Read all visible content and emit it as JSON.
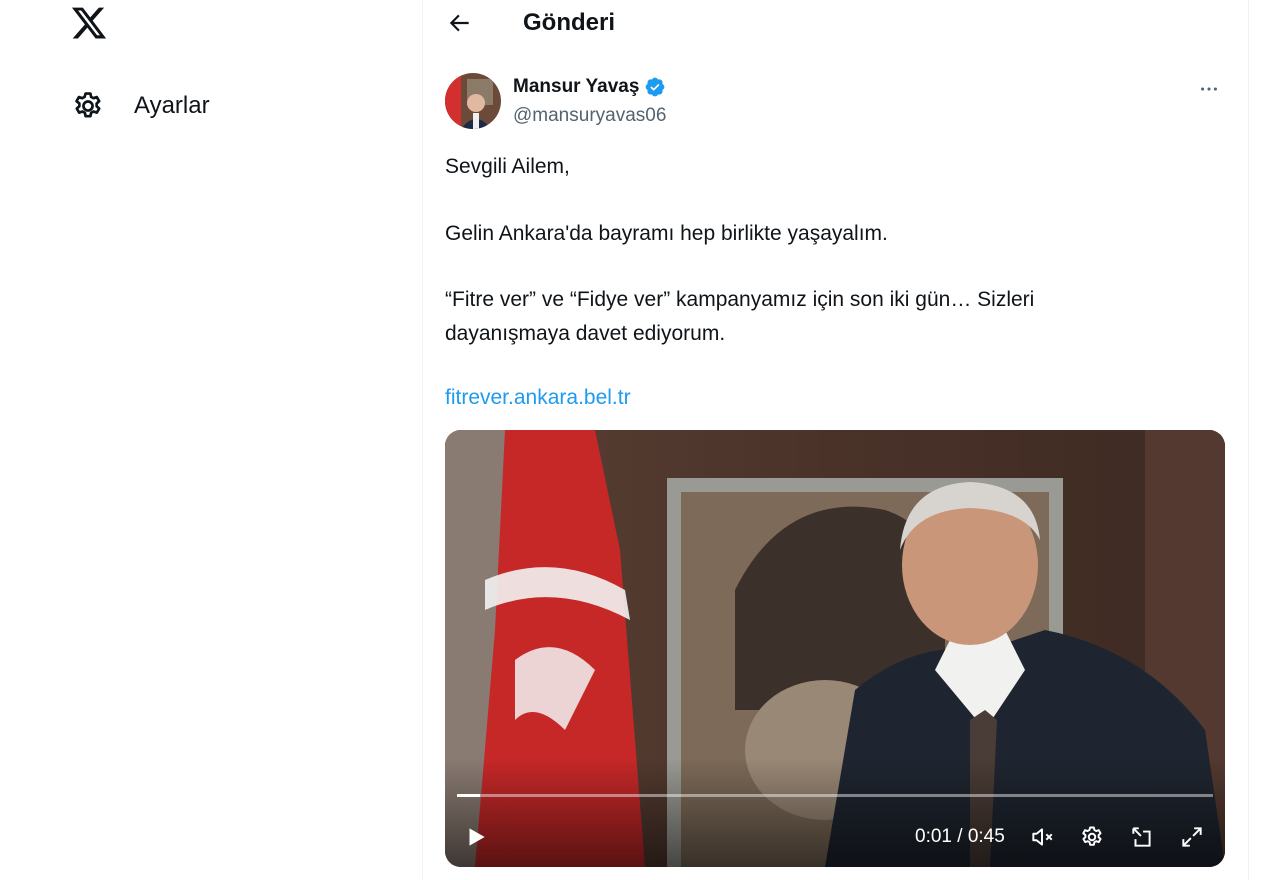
{
  "sidebar": {
    "logo_icon": "x-logo-icon",
    "items": [
      {
        "label": "Ayarlar",
        "icon": "gear-icon"
      }
    ]
  },
  "header": {
    "back_icon": "arrow-left-icon",
    "title": "Gönderi"
  },
  "post": {
    "author": {
      "name": "Mansur Yavaş",
      "handle": "@mansuryavas06",
      "verified": true,
      "verified_color": "#1d9bf0"
    },
    "more_icon": "ellipsis-icon",
    "paragraphs": [
      "Sevgili Ailem,",
      "Gelin Ankara'da bayramı hep birlikte yaşayalım.",
      "“Fitre ver” ve “Fidye ver” kampanyamız için son iki gün… Sizleri dayanışmaya davet ediyorum."
    ],
    "link": "fitrever.ankara.bel.tr",
    "link_color": "#1d9bf0"
  },
  "video": {
    "current_time": "0:01",
    "duration": "0:45",
    "time_text": "0:01 / 0:45",
    "progress": 0.03,
    "controls": [
      "play-icon",
      "mute-icon",
      "gear-icon",
      "pip-icon",
      "fullscreen-icon"
    ]
  }
}
